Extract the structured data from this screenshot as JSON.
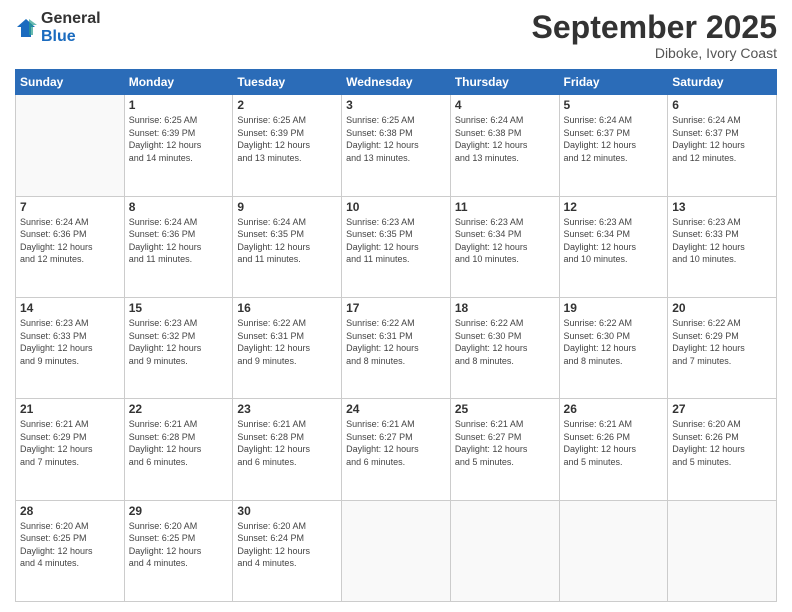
{
  "logo": {
    "general": "General",
    "blue": "Blue"
  },
  "header": {
    "month": "September 2025",
    "location": "Diboke, Ivory Coast"
  },
  "weekdays": [
    "Sunday",
    "Monday",
    "Tuesday",
    "Wednesday",
    "Thursday",
    "Friday",
    "Saturday"
  ],
  "weeks": [
    [
      {
        "day": null
      },
      {
        "day": 1,
        "sunrise": "6:25 AM",
        "sunset": "6:39 PM",
        "daylight": "12 hours and 14 minutes."
      },
      {
        "day": 2,
        "sunrise": "6:25 AM",
        "sunset": "6:39 PM",
        "daylight": "12 hours and 13 minutes."
      },
      {
        "day": 3,
        "sunrise": "6:25 AM",
        "sunset": "6:38 PM",
        "daylight": "12 hours and 13 minutes."
      },
      {
        "day": 4,
        "sunrise": "6:24 AM",
        "sunset": "6:38 PM",
        "daylight": "12 hours and 13 minutes."
      },
      {
        "day": 5,
        "sunrise": "6:24 AM",
        "sunset": "6:37 PM",
        "daylight": "12 hours and 12 minutes."
      },
      {
        "day": 6,
        "sunrise": "6:24 AM",
        "sunset": "6:37 PM",
        "daylight": "12 hours and 12 minutes."
      }
    ],
    [
      {
        "day": 7,
        "sunrise": "6:24 AM",
        "sunset": "6:36 PM",
        "daylight": "12 hours and 12 minutes."
      },
      {
        "day": 8,
        "sunrise": "6:24 AM",
        "sunset": "6:36 PM",
        "daylight": "12 hours and 11 minutes."
      },
      {
        "day": 9,
        "sunrise": "6:24 AM",
        "sunset": "6:35 PM",
        "daylight": "12 hours and 11 minutes."
      },
      {
        "day": 10,
        "sunrise": "6:23 AM",
        "sunset": "6:35 PM",
        "daylight": "12 hours and 11 minutes."
      },
      {
        "day": 11,
        "sunrise": "6:23 AM",
        "sunset": "6:34 PM",
        "daylight": "12 hours and 10 minutes."
      },
      {
        "day": 12,
        "sunrise": "6:23 AM",
        "sunset": "6:34 PM",
        "daylight": "12 hours and 10 minutes."
      },
      {
        "day": 13,
        "sunrise": "6:23 AM",
        "sunset": "6:33 PM",
        "daylight": "12 hours and 10 minutes."
      }
    ],
    [
      {
        "day": 14,
        "sunrise": "6:23 AM",
        "sunset": "6:33 PM",
        "daylight": "12 hours and 9 minutes."
      },
      {
        "day": 15,
        "sunrise": "6:23 AM",
        "sunset": "6:32 PM",
        "daylight": "12 hours and 9 minutes."
      },
      {
        "day": 16,
        "sunrise": "6:22 AM",
        "sunset": "6:31 PM",
        "daylight": "12 hours and 9 minutes."
      },
      {
        "day": 17,
        "sunrise": "6:22 AM",
        "sunset": "6:31 PM",
        "daylight": "12 hours and 8 minutes."
      },
      {
        "day": 18,
        "sunrise": "6:22 AM",
        "sunset": "6:30 PM",
        "daylight": "12 hours and 8 minutes."
      },
      {
        "day": 19,
        "sunrise": "6:22 AM",
        "sunset": "6:30 PM",
        "daylight": "12 hours and 8 minutes."
      },
      {
        "day": 20,
        "sunrise": "6:22 AM",
        "sunset": "6:29 PM",
        "daylight": "12 hours and 7 minutes."
      }
    ],
    [
      {
        "day": 21,
        "sunrise": "6:21 AM",
        "sunset": "6:29 PM",
        "daylight": "12 hours and 7 minutes."
      },
      {
        "day": 22,
        "sunrise": "6:21 AM",
        "sunset": "6:28 PM",
        "daylight": "12 hours and 6 minutes."
      },
      {
        "day": 23,
        "sunrise": "6:21 AM",
        "sunset": "6:28 PM",
        "daylight": "12 hours and 6 minutes."
      },
      {
        "day": 24,
        "sunrise": "6:21 AM",
        "sunset": "6:27 PM",
        "daylight": "12 hours and 6 minutes."
      },
      {
        "day": 25,
        "sunrise": "6:21 AM",
        "sunset": "6:27 PM",
        "daylight": "12 hours and 5 minutes."
      },
      {
        "day": 26,
        "sunrise": "6:21 AM",
        "sunset": "6:26 PM",
        "daylight": "12 hours and 5 minutes."
      },
      {
        "day": 27,
        "sunrise": "6:20 AM",
        "sunset": "6:26 PM",
        "daylight": "12 hours and 5 minutes."
      }
    ],
    [
      {
        "day": 28,
        "sunrise": "6:20 AM",
        "sunset": "6:25 PM",
        "daylight": "12 hours and 4 minutes."
      },
      {
        "day": 29,
        "sunrise": "6:20 AM",
        "sunset": "6:25 PM",
        "daylight": "12 hours and 4 minutes."
      },
      {
        "day": 30,
        "sunrise": "6:20 AM",
        "sunset": "6:24 PM",
        "daylight": "12 hours and 4 minutes."
      },
      {
        "day": null
      },
      {
        "day": null
      },
      {
        "day": null
      },
      {
        "day": null
      }
    ]
  ]
}
